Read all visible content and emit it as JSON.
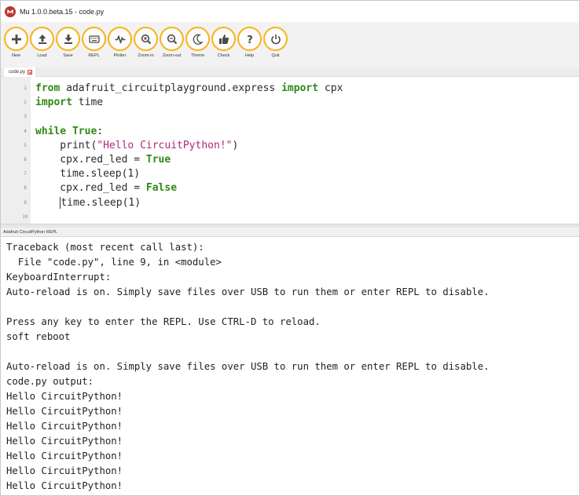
{
  "window": {
    "title": "Mu 1.0.0.beta.15 - code.py"
  },
  "toolbar": {
    "accent": "#f8b418",
    "buttons": [
      {
        "label": "New",
        "icon": "plus-icon"
      },
      {
        "label": "Load",
        "icon": "upload-icon"
      },
      {
        "label": "Save",
        "icon": "download-icon"
      },
      {
        "label": "REPL",
        "icon": "keyboard-icon"
      },
      {
        "label": "Plotter",
        "icon": "pulse-icon"
      },
      {
        "label": "Zoom-in",
        "icon": "zoom-in-icon"
      },
      {
        "label": "Zoom-out",
        "icon": "zoom-out-icon"
      },
      {
        "label": "Theme",
        "icon": "moon-icon"
      },
      {
        "label": "Check",
        "icon": "thumbs-up-icon"
      },
      {
        "label": "Help",
        "icon": "question-icon"
      },
      {
        "label": "Quit",
        "icon": "power-icon"
      }
    ]
  },
  "tab": {
    "label": "code.py"
  },
  "editor": {
    "colors": {
      "keyword": "#2e8a18",
      "string": "#b0287a"
    },
    "line_numbers": [
      "1",
      "2",
      "3",
      "4",
      "5",
      "6",
      "7",
      "8",
      "9",
      "10"
    ],
    "lines": [
      [
        {
          "t": "from",
          "k": "kw"
        },
        {
          "t": " adafruit_circuitplayground.express "
        },
        {
          "t": "import",
          "k": "kw"
        },
        {
          "t": " cpx"
        }
      ],
      [
        {
          "t": "import",
          "k": "kw"
        },
        {
          "t": " time"
        }
      ],
      [],
      [
        {
          "t": "while",
          "k": "kw"
        },
        {
          "t": " "
        },
        {
          "t": "True",
          "k": "kw"
        },
        {
          "t": ":"
        }
      ],
      [
        {
          "t": "    print("
        },
        {
          "t": "\"Hello CircuitPython!\"",
          "k": "str"
        },
        {
          "t": ")"
        }
      ],
      [
        {
          "t": "    cpx.red_led = "
        },
        {
          "t": "True",
          "k": "kw"
        }
      ],
      [
        {
          "t": "    time.sleep(1)"
        }
      ],
      [
        {
          "t": "    cpx.red_led = "
        },
        {
          "t": "False",
          "k": "kw"
        }
      ],
      [
        {
          "t": "    "
        },
        {
          "t": "time.sleep(1)",
          "k": "caret"
        }
      ],
      []
    ]
  },
  "repl": {
    "title": "Adafruit CircuitPython REPL",
    "lines": [
      "Traceback (most recent call last):",
      "  File \"code.py\", line 9, in <module>",
      "KeyboardInterrupt:",
      "Auto-reload is on. Simply save files over USB to run them or enter REPL to disable.",
      "",
      "Press any key to enter the REPL. Use CTRL-D to reload.",
      "soft reboot",
      "",
      "Auto-reload is on. Simply save files over USB to run them or enter REPL to disable.",
      "code.py output:",
      "Hello CircuitPython!",
      "Hello CircuitPython!",
      "Hello CircuitPython!",
      "Hello CircuitPython!",
      "Hello CircuitPython!",
      "Hello CircuitPython!",
      "Hello CircuitPython!",
      "Hello CircuitPython!"
    ]
  }
}
